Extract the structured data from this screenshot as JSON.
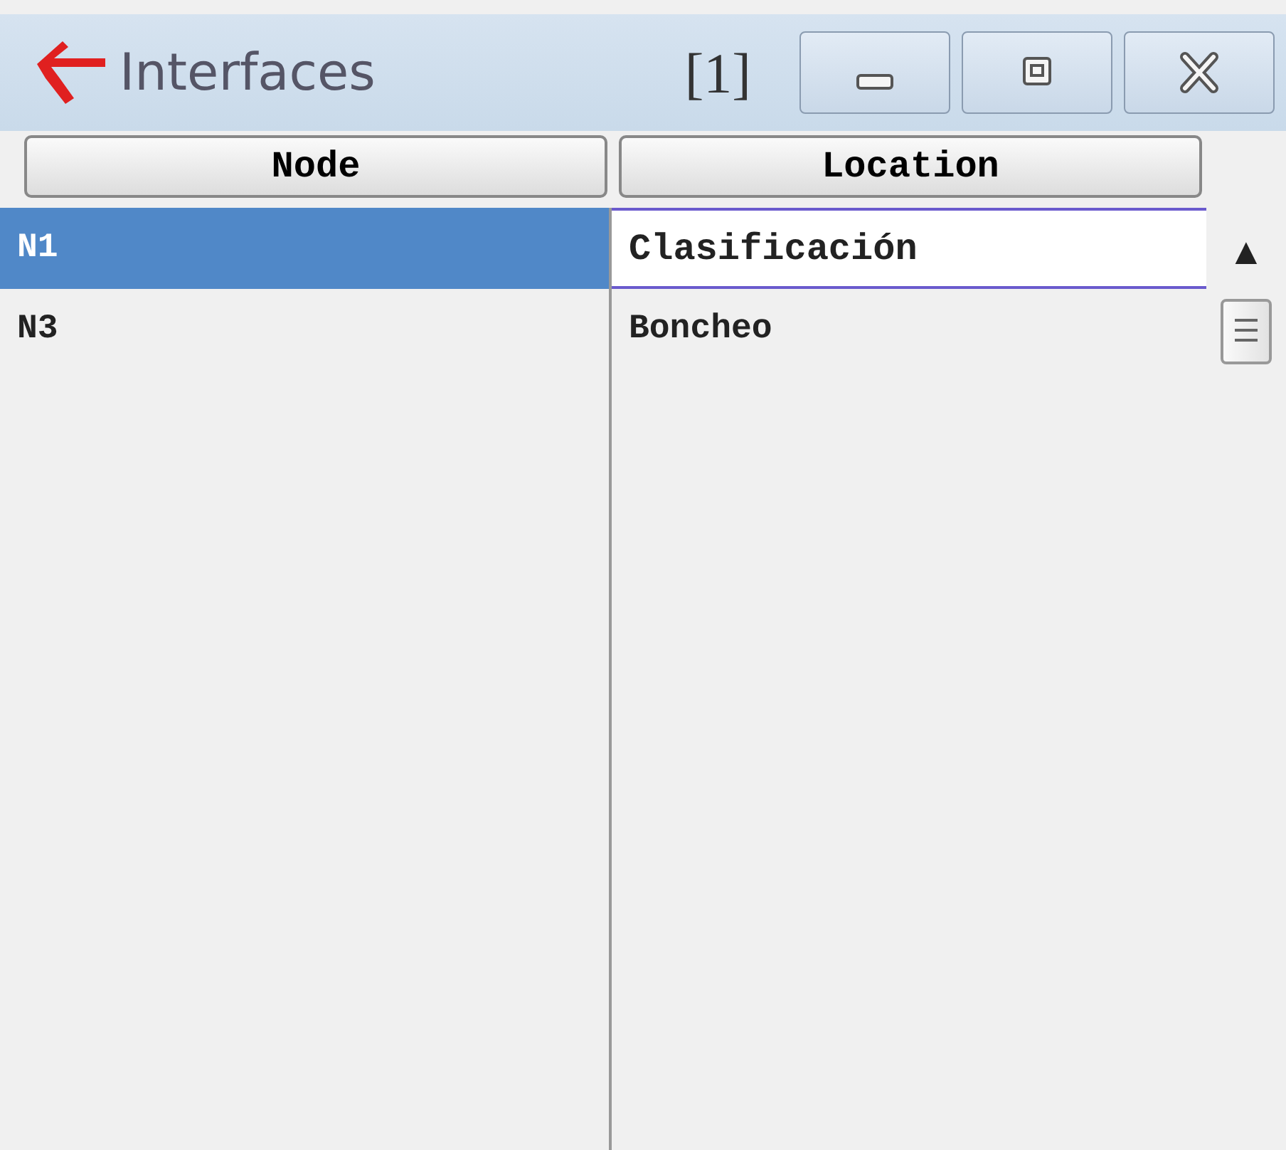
{
  "window": {
    "title": "Interfaces",
    "badge": "[1]"
  },
  "table": {
    "columns": [
      "Node",
      "Location"
    ],
    "rows": [
      {
        "cells": [
          "N1",
          "Clasificación"
        ],
        "selected": true
      },
      {
        "cells": [
          "N3",
          "Boncheo"
        ],
        "selected": false
      }
    ]
  },
  "scroll_bar": {
    "up_arrow": "▲"
  }
}
